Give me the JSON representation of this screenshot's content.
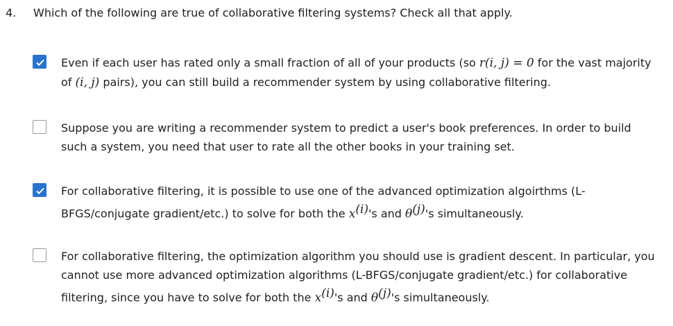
{
  "question": {
    "number": "4.",
    "text": "Which of the following are true of collaborative filtering systems? Check all that apply."
  },
  "accent_color": "#2a73cc",
  "options": [
    {
      "checked": true,
      "segments": [
        {
          "t": "Even if each user has rated only a small fraction of all of your products (so "
        },
        {
          "t": "r(i, j) = 0",
          "math": true
        },
        {
          "t": " for the vast majority of "
        },
        {
          "t": "(i, j)",
          "math": true
        },
        {
          "t": " pairs), you can still build a recommender system by using collaborative filtering."
        }
      ]
    },
    {
      "checked": false,
      "segments": [
        {
          "t": "Suppose you are writing a recommender system to predict a user's book preferences. In order to build such a system, you need that user to rate all the other books in your training set."
        }
      ]
    },
    {
      "checked": true,
      "segments": [
        {
          "t": "For collaborative filtering, it is possible to use one of the advanced optimization algoirthms (L-BFGS/conjugate gradient/etc.) to solve for both the "
        },
        {
          "t": "x",
          "math": true,
          "sup": "(i)"
        },
        {
          "t": "'s and "
        },
        {
          "t": "θ",
          "math": true,
          "sup": "(j)"
        },
        {
          "t": "'s simultaneously."
        }
      ]
    },
    {
      "checked": false,
      "segments": [
        {
          "t": "For collaborative filtering, the optimization algorithm you should use is gradient descent. In particular, you cannot use more advanced optimization algorithms (L-BFGS/conjugate gradient/etc.) for collaborative filtering, since you have to solve for both the "
        },
        {
          "t": "x",
          "math": true,
          "sup": "(i)"
        },
        {
          "t": "'s and "
        },
        {
          "t": "θ",
          "math": true,
          "sup": "(j)"
        },
        {
          "t": "'s simultaneously."
        }
      ]
    }
  ]
}
